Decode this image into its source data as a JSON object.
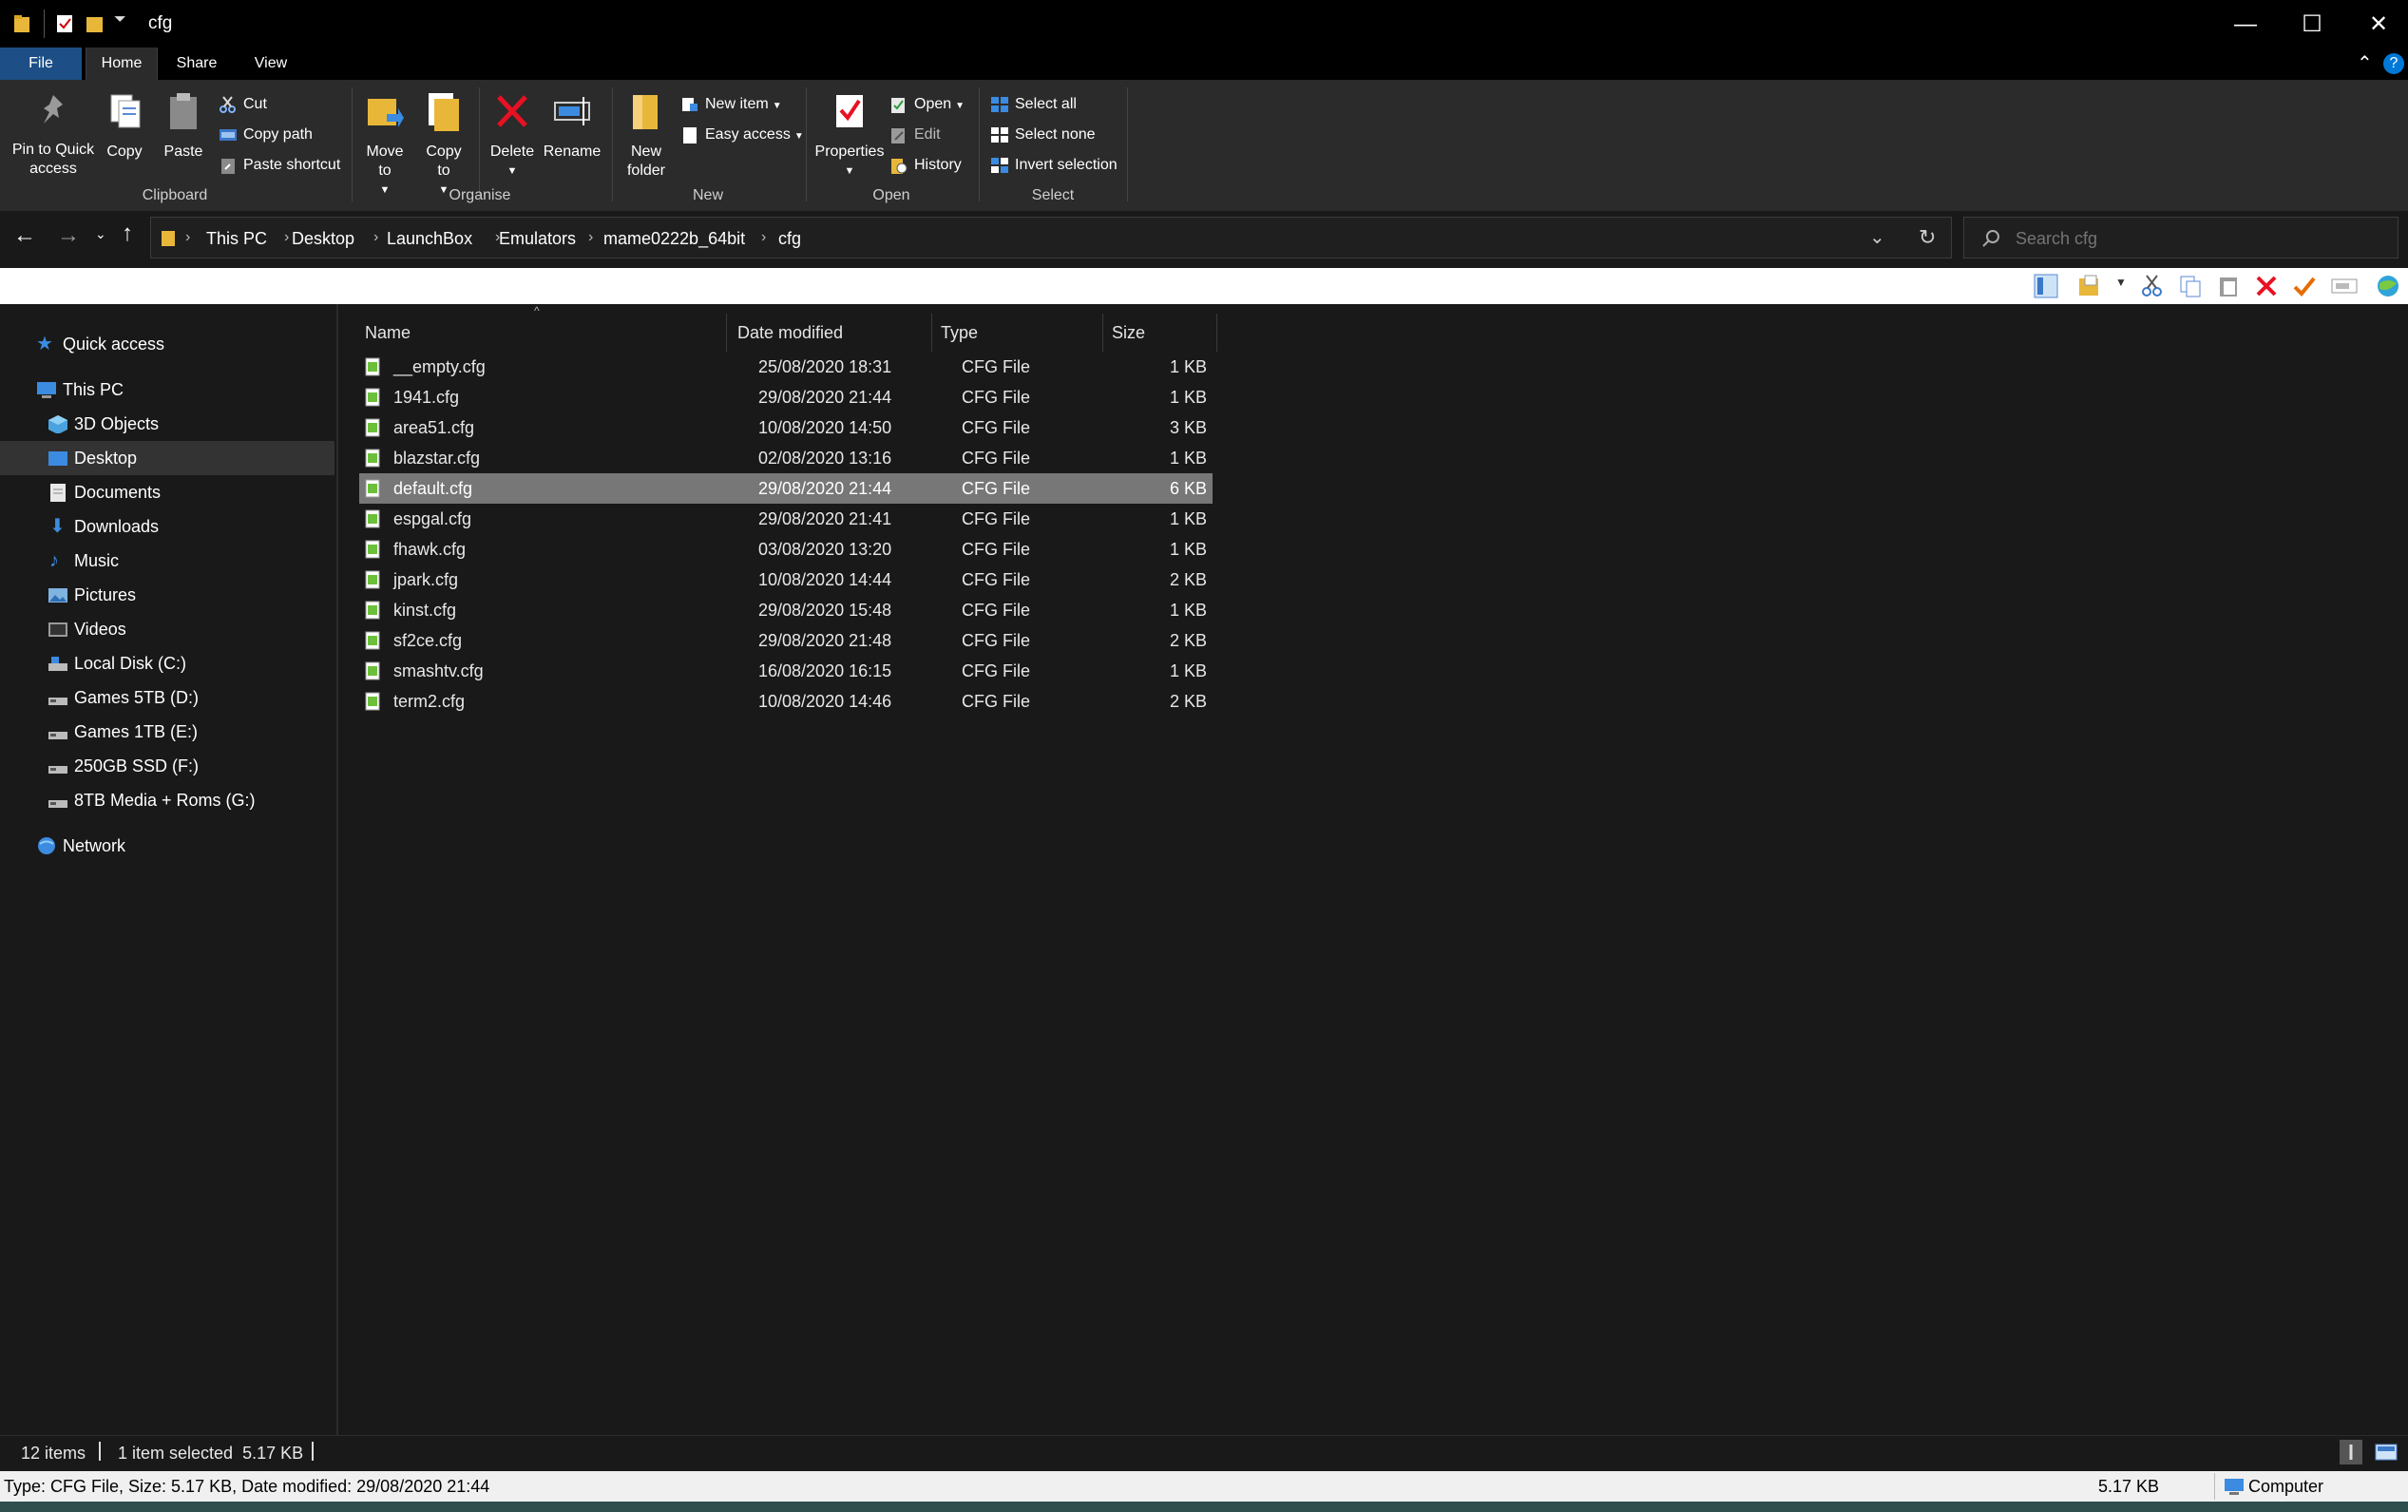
{
  "window": {
    "title": "cfg",
    "minimize": "—",
    "maximize": "☐",
    "close": "✕"
  },
  "ribbon_tabs": [
    "File",
    "Home",
    "Share",
    "View"
  ],
  "ribbon": {
    "clipboard": {
      "pin": "Pin to Quick access",
      "copy": "Copy",
      "paste": "Paste",
      "cut": "Cut",
      "copy_path": "Copy path",
      "paste_shortcut": "Paste shortcut",
      "group": "Clipboard"
    },
    "organise": {
      "move_to": "Move to",
      "copy_to": "Copy to",
      "delete": "Delete",
      "rename": "Rename",
      "group": "Organise"
    },
    "new": {
      "new_folder": "New folder",
      "new_item": "New item",
      "easy_access": "Easy access",
      "group": "New"
    },
    "open": {
      "properties": "Properties",
      "open": "Open",
      "edit": "Edit",
      "history": "History",
      "group": "Open"
    },
    "select": {
      "select_all": "Select all",
      "select_none": "Select none",
      "invert": "Invert selection",
      "group": "Select"
    }
  },
  "address": {
    "crumbs": [
      "This PC",
      "Desktop",
      "LaunchBox",
      "Emulators",
      "mame0222b_64bit",
      "cfg"
    ],
    "search_placeholder": "Search cfg"
  },
  "nav": {
    "quick_access": "Quick access",
    "this_pc": "This PC",
    "items": [
      "3D Objects",
      "Desktop",
      "Documents",
      "Downloads",
      "Music",
      "Pictures",
      "Videos",
      "Local Disk (C:)",
      "Games 5TB (D:)",
      "Games 1TB (E:)",
      "250GB SSD (F:)",
      "8TB Media + Roms (G:)"
    ],
    "network": "Network",
    "selected": "Desktop"
  },
  "columns": [
    "Name",
    "Date modified",
    "Type",
    "Size"
  ],
  "files": [
    {
      "name": "__empty.cfg",
      "date": "25/08/2020 18:31",
      "type": "CFG File",
      "size": "1 KB"
    },
    {
      "name": "1941.cfg",
      "date": "29/08/2020 21:44",
      "type": "CFG File",
      "size": "1 KB"
    },
    {
      "name": "area51.cfg",
      "date": "10/08/2020 14:50",
      "type": "CFG File",
      "size": "3 KB"
    },
    {
      "name": "blazstar.cfg",
      "date": "02/08/2020 13:16",
      "type": "CFG File",
      "size": "1 KB"
    },
    {
      "name": "default.cfg",
      "date": "29/08/2020 21:44",
      "type": "CFG File",
      "size": "6 KB"
    },
    {
      "name": "espgal.cfg",
      "date": "29/08/2020 21:41",
      "type": "CFG File",
      "size": "1 KB"
    },
    {
      "name": "fhawk.cfg",
      "date": "03/08/2020 13:20",
      "type": "CFG File",
      "size": "1 KB"
    },
    {
      "name": "jpark.cfg",
      "date": "10/08/2020 14:44",
      "type": "CFG File",
      "size": "2 KB"
    },
    {
      "name": "kinst.cfg",
      "date": "29/08/2020 15:48",
      "type": "CFG File",
      "size": "1 KB"
    },
    {
      "name": "sf2ce.cfg",
      "date": "29/08/2020 21:48",
      "type": "CFG File",
      "size": "2 KB"
    },
    {
      "name": "smashtv.cfg",
      "date": "16/08/2020 16:15",
      "type": "CFG File",
      "size": "1 KB"
    },
    {
      "name": "term2.cfg",
      "date": "10/08/2020 14:46",
      "type": "CFG File",
      "size": "2 KB"
    }
  ],
  "selected_file": "default.cfg",
  "status": {
    "count": "12 items",
    "selection": "1 item selected  5.17 KB",
    "details": "Type: CFG File, Size: 5.17 KB, Date modified: 29/08/2020 21:44",
    "size": "5.17 KB",
    "location": "Computer"
  },
  "colors": {
    "file_tab": "#1d4f86",
    "selection_row": "#777777",
    "accent_blue": "#0078d7"
  }
}
